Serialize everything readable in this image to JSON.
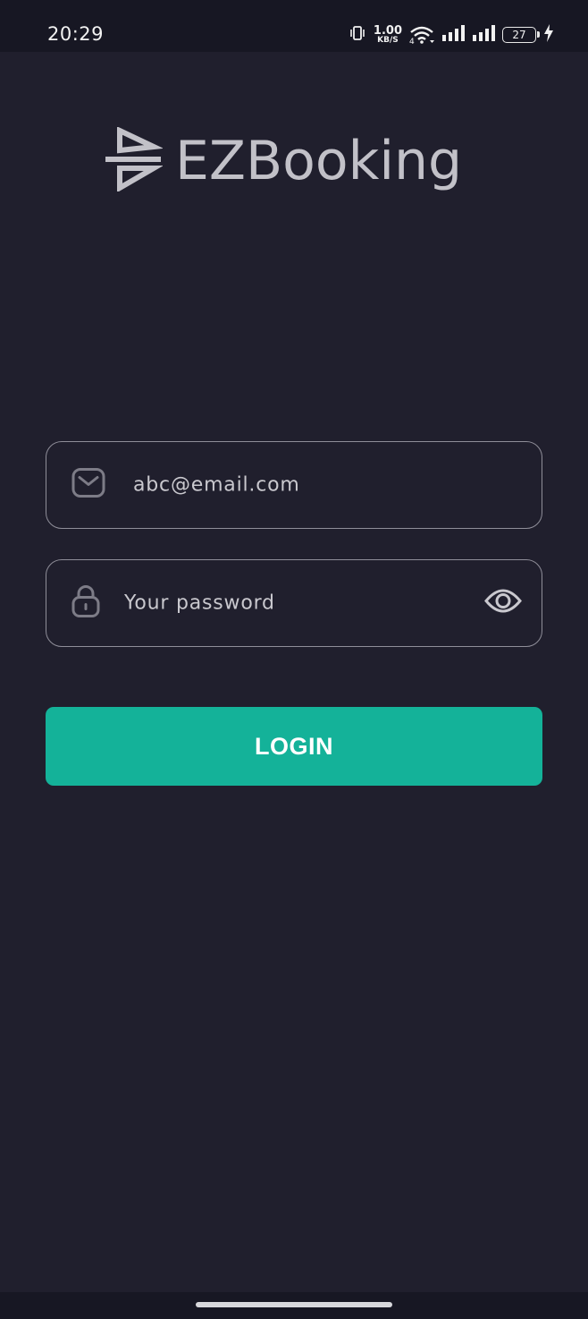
{
  "status_bar": {
    "time": "20:29",
    "net_speed_value": "1.00",
    "net_speed_unit": "KB/S",
    "wifi_badge": "4",
    "battery_level": "27",
    "icons": [
      "vibrate-icon",
      "wifi-icon",
      "signal-icon",
      "signal-icon",
      "battery-icon",
      "charging-icon"
    ]
  },
  "app": {
    "name": "EZBooking",
    "logo_icon": "ezbooking-logo-icon"
  },
  "form": {
    "email": {
      "value": "abc@email.com",
      "icon": "mail-icon"
    },
    "password": {
      "placeholder": "Your password",
      "icon": "lock-icon",
      "toggle_icon": "eye-icon"
    },
    "login_label": "LOGIN"
  },
  "colors": {
    "background": "#201f2d",
    "status_bar": "#171723",
    "accent": "#14b299",
    "field_border": "#8f8e99",
    "text": "#c9c8ce"
  }
}
